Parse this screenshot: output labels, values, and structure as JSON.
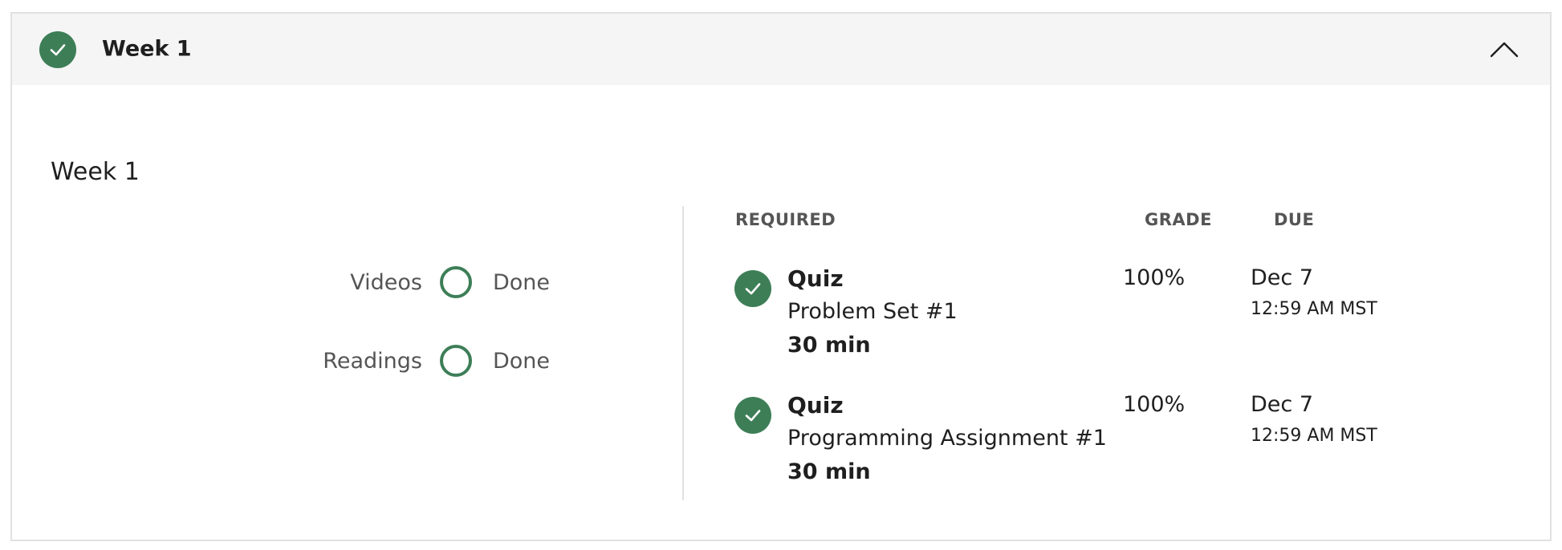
{
  "header": {
    "title": "Week 1",
    "status_icon": "check-circle-icon",
    "collapse_icon": "chevron-up-icon"
  },
  "section": {
    "title": "Week 1"
  },
  "progress": [
    {
      "label": "Videos",
      "status": "Done"
    },
    {
      "label": "Readings",
      "status": "Done"
    }
  ],
  "columns": {
    "required": "REQUIRED",
    "grade": "GRADE",
    "due": "DUE"
  },
  "items": [
    {
      "type": "Quiz",
      "name": "Problem Set #1",
      "duration": "30 min",
      "grade": "100%",
      "due_date": "Dec 7",
      "due_time": "12:59 AM MST"
    },
    {
      "type": "Quiz",
      "name": "Programming Assignment #1",
      "duration": "30 min",
      "grade": "100%",
      "due_date": "Dec 7",
      "due_time": "12:59 AM MST"
    }
  ],
  "colors": {
    "accent_green": "#3d7e57",
    "header_bg": "#f5f5f5",
    "border": "#e1e1e1"
  }
}
